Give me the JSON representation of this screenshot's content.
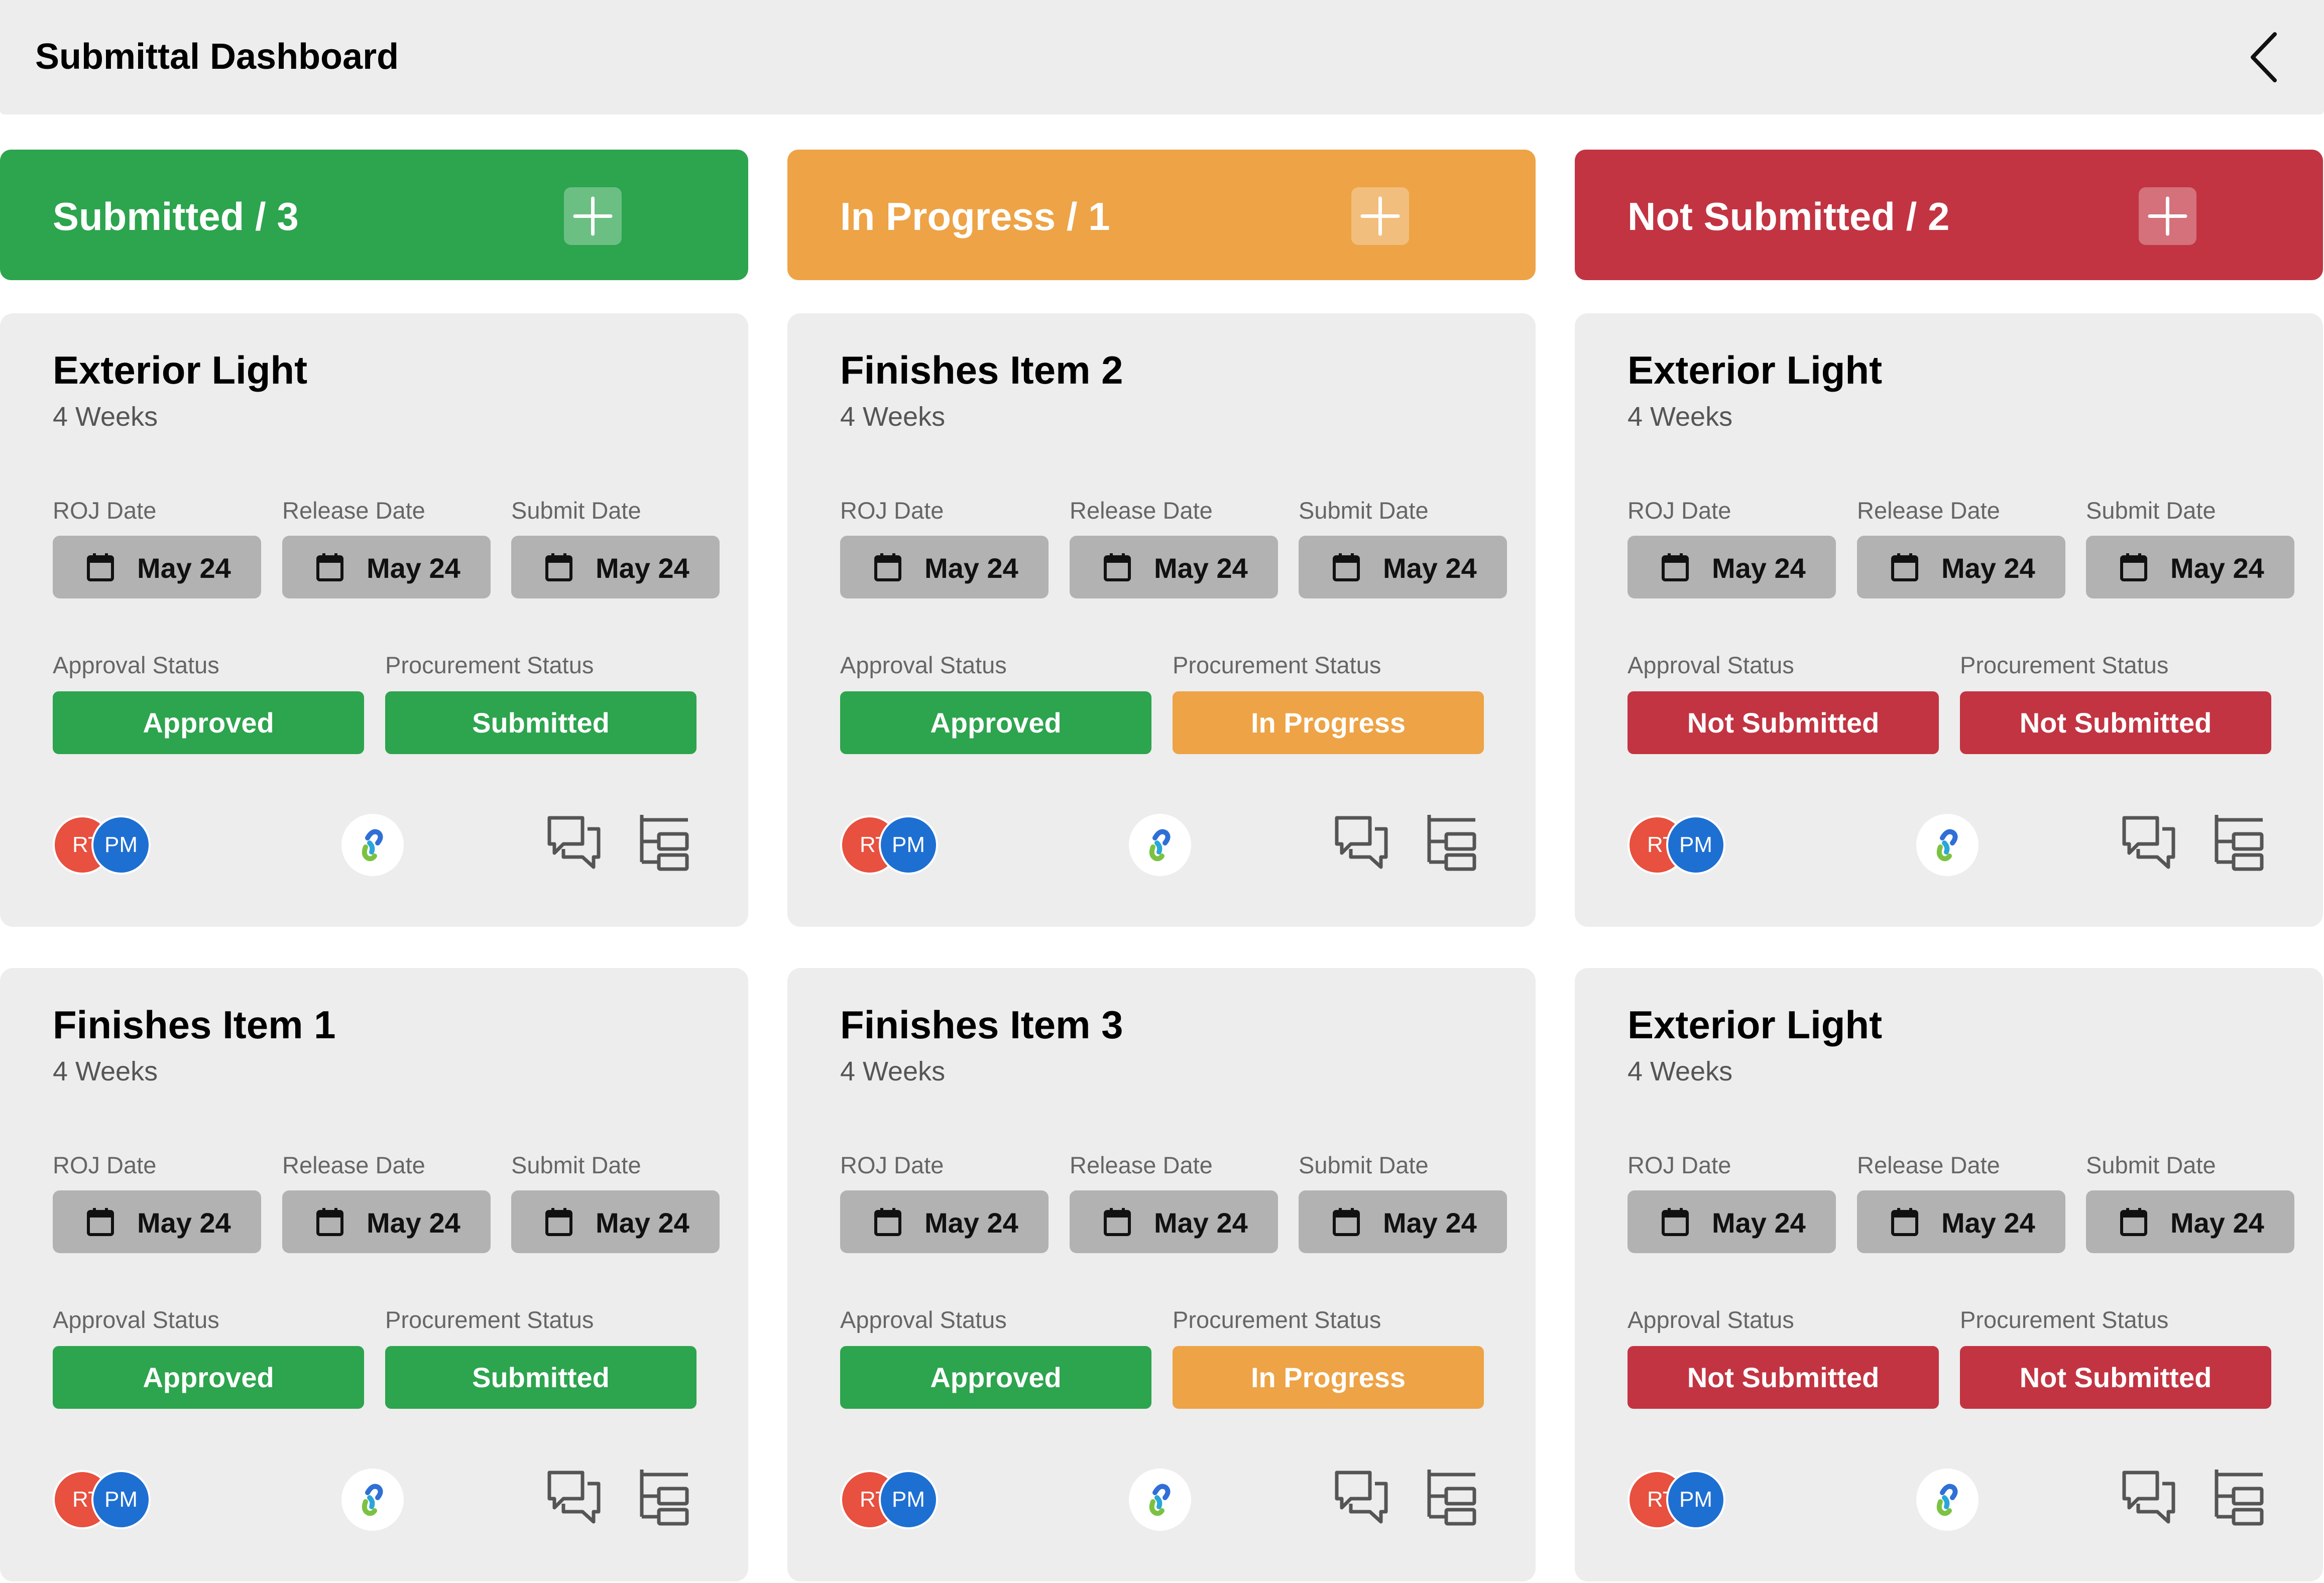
{
  "header": {
    "title": "Submittal Dashboard"
  },
  "colors": {
    "green": "#2da44e",
    "orange": "#eda346",
    "red": "#c23442",
    "chip_gray": "#b2b2b2",
    "card_bg": "#ededed"
  },
  "columns": [
    {
      "label": "Submitted / 3"
    },
    {
      "label": "In Progress / 1"
    },
    {
      "label": "Not Submitted / 2"
    }
  ],
  "field_labels": {
    "roj": "ROJ Date",
    "release": "Release Date",
    "submit": "Submit Date",
    "approval": "Approval Status",
    "procurement": "Procurement Status"
  },
  "avatars": {
    "first": "RT",
    "second": "PM"
  },
  "icons": {
    "back": "chevron-left-icon",
    "add": "plus-icon",
    "calendar": "calendar-icon",
    "comment": "comments-icon",
    "hierarchy": "hierarchy-icon",
    "logo": "app-logo-icon"
  },
  "cards": [
    {
      "title": "Exterior Light",
      "duration": "4 Weeks",
      "roj": "May 24",
      "release": "May 24",
      "submit": "May 24",
      "approval": "Approved",
      "procurement": "Submitted"
    },
    {
      "title": "Finishes Item 2",
      "duration": "4 Weeks",
      "roj": "May 24",
      "release": "May 24",
      "submit": "May 24",
      "approval": "Approved",
      "procurement": "In Progress"
    },
    {
      "title": "Exterior Light",
      "duration": "4 Weeks",
      "roj": "May 24",
      "release": "May 24",
      "submit": "May 24",
      "approval": "Not Submitted",
      "procurement": "Not Submitted"
    },
    {
      "title": "Finishes Item 1",
      "duration": "4 Weeks",
      "roj": "May 24",
      "release": "May 24",
      "submit": "May 24",
      "approval": "Approved",
      "procurement": "Submitted"
    },
    {
      "title": "Finishes Item 3",
      "duration": "4 Weeks",
      "roj": "May 24",
      "release": "May 24",
      "submit": "May 24",
      "approval": "Approved",
      "procurement": "In Progress"
    },
    {
      "title": "Exterior Light",
      "duration": "4 Weeks",
      "roj": "May 24",
      "release": "May 24",
      "submit": "May 24",
      "approval": "Not Submitted",
      "procurement": "Not Submitted"
    }
  ]
}
